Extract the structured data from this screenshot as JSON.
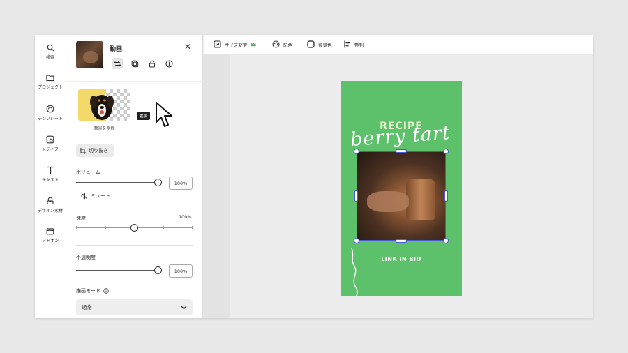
{
  "rail": {
    "items": [
      {
        "icon": "search-icon",
        "label": "検索"
      },
      {
        "icon": "folder-icon",
        "label": "プロジェクト"
      },
      {
        "icon": "template-icon",
        "label": "テンプレート"
      },
      {
        "icon": "media-icon",
        "label": "メディア"
      },
      {
        "icon": "text-icon",
        "label": "テキスト"
      },
      {
        "icon": "design-assets-icon",
        "label": "デザイン素材"
      },
      {
        "icon": "addon-icon",
        "label": "アドオン"
      }
    ]
  },
  "panel": {
    "title": "動画",
    "tooltip": "置換",
    "remove_bg_label": "背景を削除",
    "crop_label": "切り抜き",
    "volume_label": "ボリューム",
    "volume_value": "100%",
    "volume_level": 1.0,
    "mute_label": "ミュート",
    "speed_label": "速度",
    "speed_value": "100%",
    "speed_level": 0.5,
    "opacity_label": "不透明度",
    "opacity_value": "100%",
    "opacity_level": 1.0,
    "blend_label": "描画モード",
    "blend_value": "通常"
  },
  "toolbar": {
    "resize_label": "サイズ変更",
    "color_label": "配色",
    "bgcolor_label": "背景色",
    "arrange_label": "整列"
  },
  "design": {
    "recipe": "RECIPE",
    "script_title": "berry tart",
    "link": "LINK IN BIO",
    "bg_color": "#5dc16c"
  }
}
